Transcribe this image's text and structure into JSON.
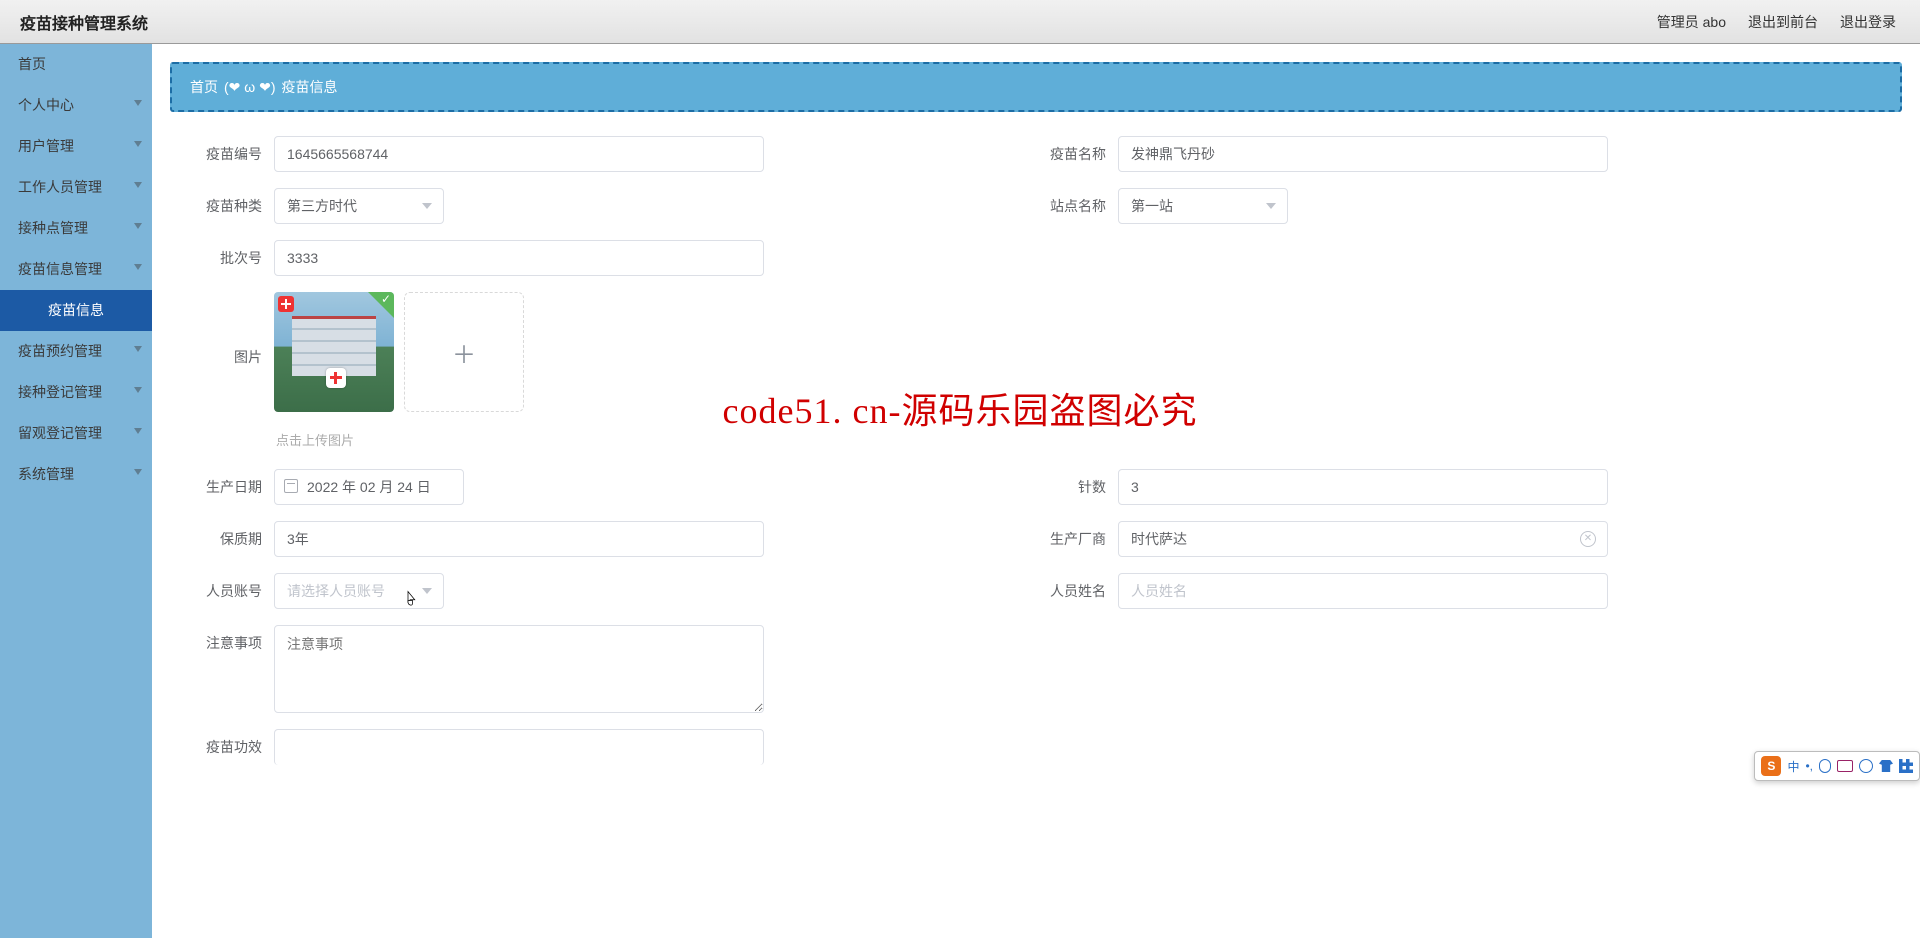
{
  "watermark": "code51.cn",
  "overlay": "code51. cn-源码乐园盗图必究",
  "header": {
    "title": "疫苗接种管理系统",
    "admin": "管理员 abo",
    "to_front": "退出到前台",
    "logout": "退出登录"
  },
  "sidebar": {
    "items": [
      "首页",
      "个人中心",
      "用户管理",
      "工作人员管理",
      "接种点管理",
      "疫苗信息管理",
      "疫苗预约管理",
      "接种登记管理",
      "留观登记管理",
      "系统管理"
    ],
    "active_sub": "疫苗信息"
  },
  "breadcrumb": {
    "home": "首页",
    "face": "(❤ ω ❤)",
    "current": "疫苗信息"
  },
  "form": {
    "labels": {
      "yimiao_id": "疫苗编号",
      "yimiao_name": "疫苗名称",
      "yimiao_type": "疫苗种类",
      "site_name": "站点名称",
      "batch": "批次号",
      "image": "图片",
      "upload_tip": "点击上传图片",
      "produce_date": "生产日期",
      "doses": "针数",
      "shelf_life": "保质期",
      "manufacturer": "生产厂商",
      "staff_account": "人员账号",
      "staff_name": "人员姓名",
      "notes": "注意事项",
      "efficacy": "疫苗功效"
    },
    "values": {
      "yimiao_id": "1645665568744",
      "yimiao_name": "发神鼎飞丹砂",
      "yimiao_type": "第三方时代",
      "site_name": "第一站",
      "batch": "3333",
      "produce_date": "2022 年 02 月 24 日",
      "doses": "3",
      "shelf_life": "3年",
      "manufacturer": "时代萨达",
      "staff_account": "",
      "staff_name": "",
      "notes": ""
    },
    "placeholders": {
      "staff_account": "请选择人员账号",
      "staff_name": "人员姓名",
      "notes": "注意事项"
    }
  },
  "ime": {
    "logo": "S",
    "label": "中"
  }
}
